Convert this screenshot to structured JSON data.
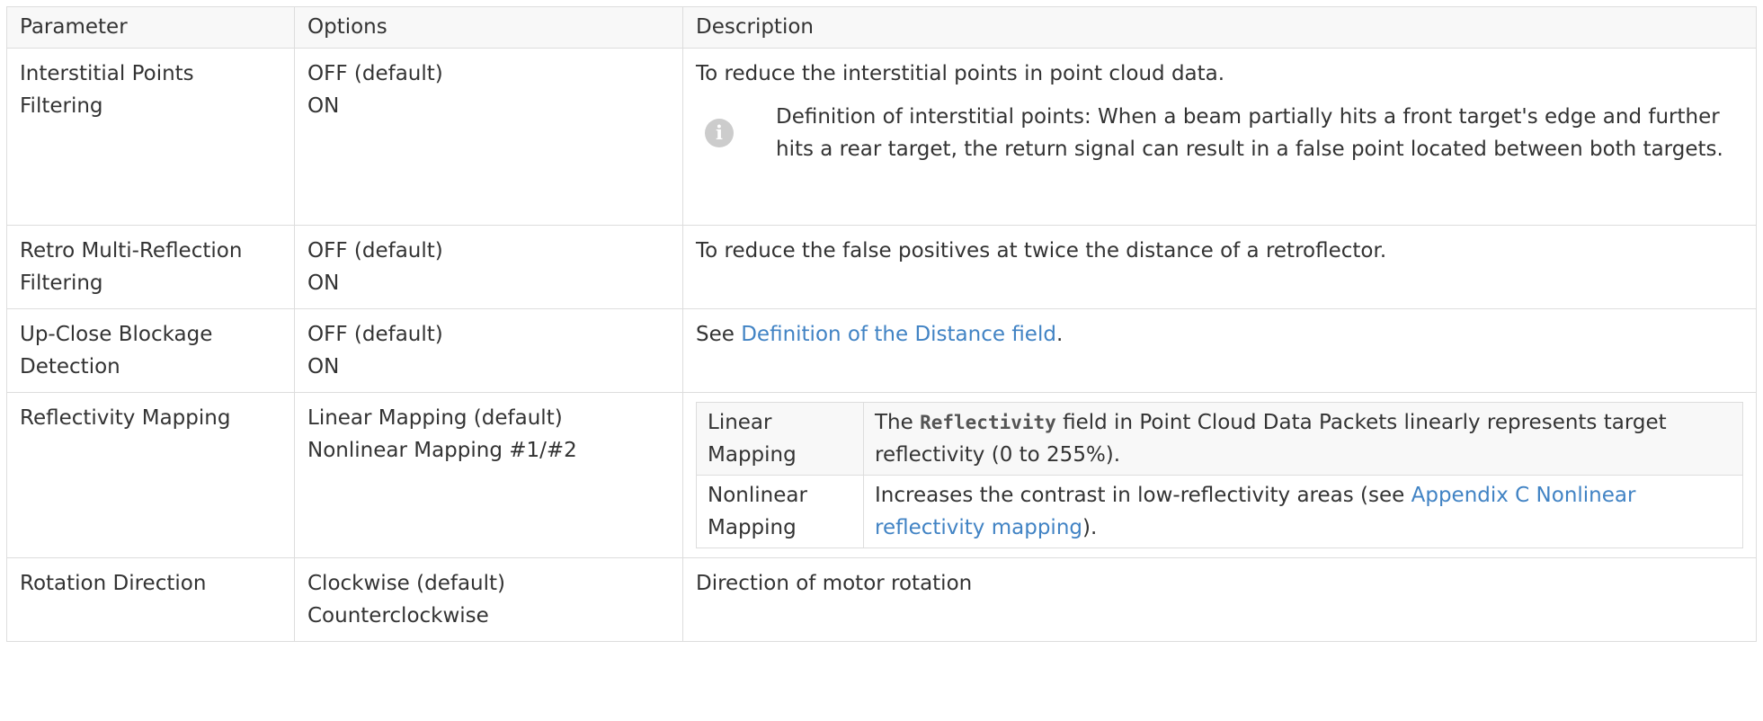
{
  "table": {
    "headers": [
      "Parameter",
      "Options",
      "Description"
    ],
    "rows": [
      {
        "parameter": "Interstitial Points Filtering",
        "options": [
          "OFF (default)",
          "ON"
        ],
        "description": "To reduce the interstitial points in point cloud data.",
        "note": "Definition of interstitial points: When a beam partially hits a front target's edge and further hits a rear target, the return signal can result in a false point located between both targets."
      },
      {
        "parameter": "Retro Multi-Reflection Filtering",
        "options": [
          "OFF (default)",
          "ON"
        ],
        "description": "To reduce the false positives at twice the distance of a retroflector."
      },
      {
        "parameter": "Up-Close Blockage Detection",
        "options": [
          "OFF (default)",
          "ON"
        ],
        "description_prefix": "See ",
        "description_link": "Definition of the Distance field",
        "description_suffix": "."
      },
      {
        "parameter": "Reflectivity Mapping",
        "options": [
          "Linear Mapping (default)",
          "Nonlinear Mapping #1/#2"
        ],
        "mapping_table": [
          {
            "name": "Linear Mapping",
            "text_prefix": "The ",
            "code": "Reflectivity",
            "text_suffix": " field in Point Cloud Data Packets linearly represents target reflectivity (0 to 255%)."
          },
          {
            "name": "Nonlinear Mapping",
            "text_prefix": "Increases the contrast in low-reflectivity areas (see ",
            "link": "Appendix C Nonlinear reflectivity mapping",
            "text_suffix": ")."
          }
        ]
      },
      {
        "parameter": "Rotation Direction",
        "options": [
          "Clockwise (default)",
          "Counterclockwise"
        ],
        "description": "Direction of motor rotation"
      }
    ]
  },
  "icons": {
    "note_icon": "info-icon",
    "note_icon_glyph": "i"
  },
  "colors": {
    "link": "#4183c4",
    "icon_bg": "#cccccc",
    "border": "#dddddd",
    "header_bg": "#f8f8f8"
  }
}
